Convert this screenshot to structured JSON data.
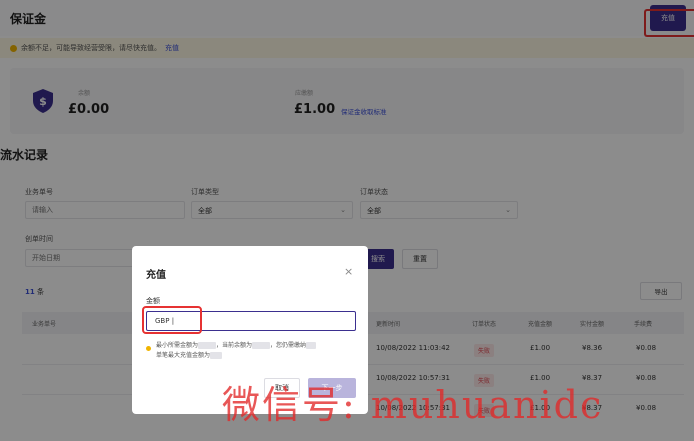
{
  "header": {
    "title": "保证金",
    "recharge_label": "充值"
  },
  "notice": {
    "text": "余额不足，可能导致经营受限，请尽快充值。",
    "link": "充值"
  },
  "balance": {
    "balance_label": "余额",
    "balance_value": "£0.00",
    "due_label": "应缴额",
    "due_value": "£1.00",
    "due_link": "保证金收取标准"
  },
  "records": {
    "title": "流水记录",
    "filters": {
      "order_no_label": "业务单号",
      "order_no_placeholder": "请输入",
      "order_type_label": "订单类型",
      "order_type_value": "全部",
      "order_status_label": "订单状态",
      "order_status_value": "全部",
      "created_label": "创单时间",
      "created_placeholder": "开始日期"
    },
    "search_label": "搜索",
    "reset_label": "重置",
    "count": "11",
    "count_unit": "条",
    "export_label": "导出",
    "columns": [
      "业务单号",
      "更新时间",
      "订单状态",
      "充值金额",
      "实付金额",
      "手续费"
    ],
    "rows": [
      {
        "time": "10/08/2022 11:03:42",
        "status": "失败",
        "recharge": "£1.00",
        "paid": "¥8.36",
        "fee": "¥0.08"
      },
      {
        "time": "10/08/2022 10:57:31",
        "status": "失败",
        "recharge": "£1.00",
        "paid": "¥8.37",
        "fee": "¥0.08"
      },
      {
        "time": "10/08/2022 10:57:31",
        "status": "失败",
        "recharge": "£1.00",
        "paid": "¥8.37",
        "fee": "¥0.08"
      }
    ]
  },
  "modal": {
    "title": "充值",
    "close": "×",
    "amount_label": "金额",
    "amount_value": "GBP",
    "hint_a": "最小所需金额为",
    "hint_b": "，当前余额为",
    "hint_c": "，您仍需缴纳",
    "hint_line2": "单笔最大充值金额为",
    "cancel_label": "取消",
    "next_label": "下一步"
  },
  "watermark": "微信号: muhuanidc",
  "colors": {
    "primary": "#3b2f8f",
    "link": "#3b4fd8",
    "danger": "#e0424b",
    "warning": "#f0b400"
  }
}
